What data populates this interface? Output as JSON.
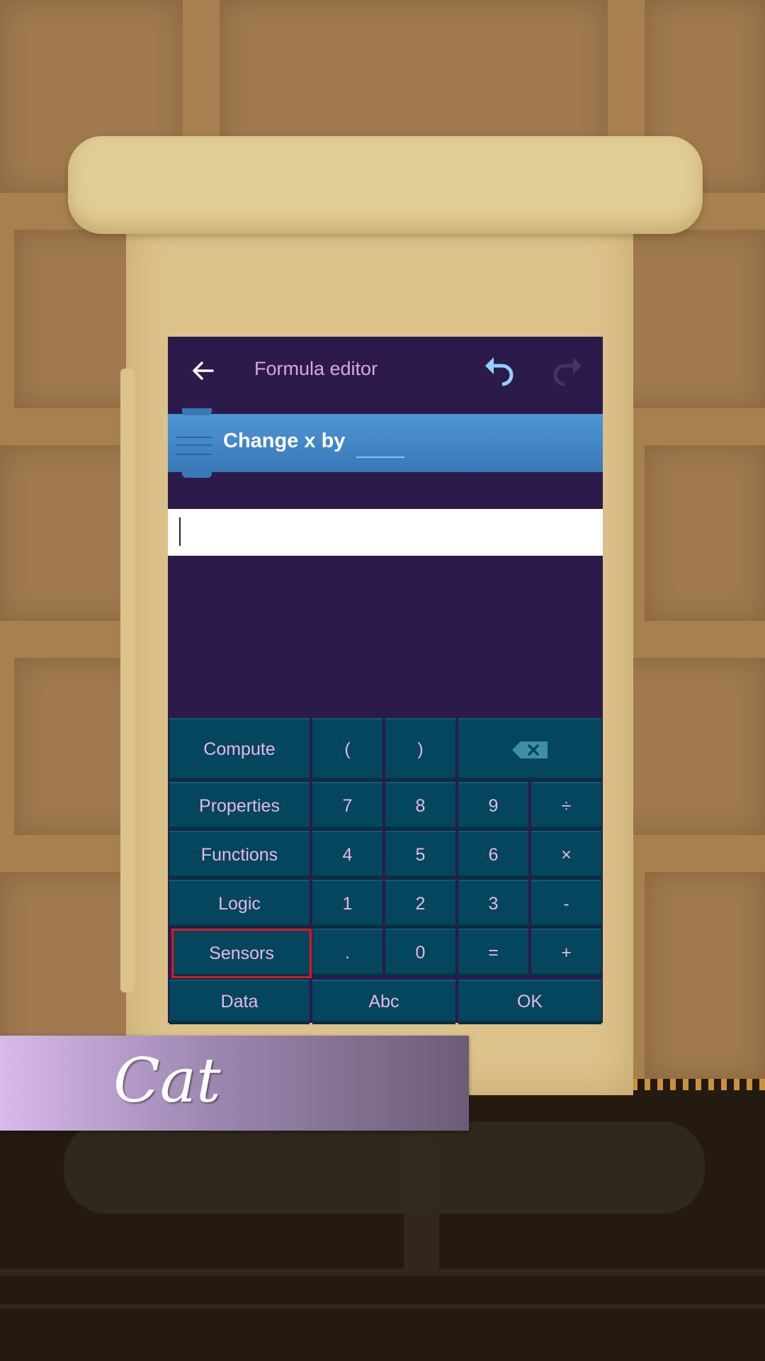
{
  "editor": {
    "title": "Formula editor",
    "back_icon": "arrow-left-icon",
    "undo_icon": "undo-icon",
    "redo_icon": "redo-icon",
    "redo_enabled": false
  },
  "brick": {
    "label": "Change x by",
    "color": "#4e96d3"
  },
  "formula": {
    "value": ""
  },
  "keypad": {
    "compute": "Compute",
    "open_paren": "(",
    "close_paren": ")",
    "backspace_icon": "backspace-icon",
    "properties": "Properties",
    "functions": "Functions",
    "logic": "Logic",
    "sensors": "Sensors",
    "data": "Data",
    "abc": "Abc",
    "ok": "OK",
    "digits": [
      "0",
      "1",
      "2",
      "3",
      "4",
      "5",
      "6",
      "7",
      "8",
      "9"
    ],
    "decimal": ".",
    "equals": "=",
    "divide": "÷",
    "multiply": "×",
    "minus": "-",
    "plus": "+",
    "selected_key": "Sensors"
  },
  "sprite_banner": {
    "name": "Cat"
  },
  "colors": {
    "toolbar": "#2c1a4b",
    "key_bg": "#03465e",
    "key_text": "#e9b7e6",
    "highlight": "#e0161e"
  }
}
